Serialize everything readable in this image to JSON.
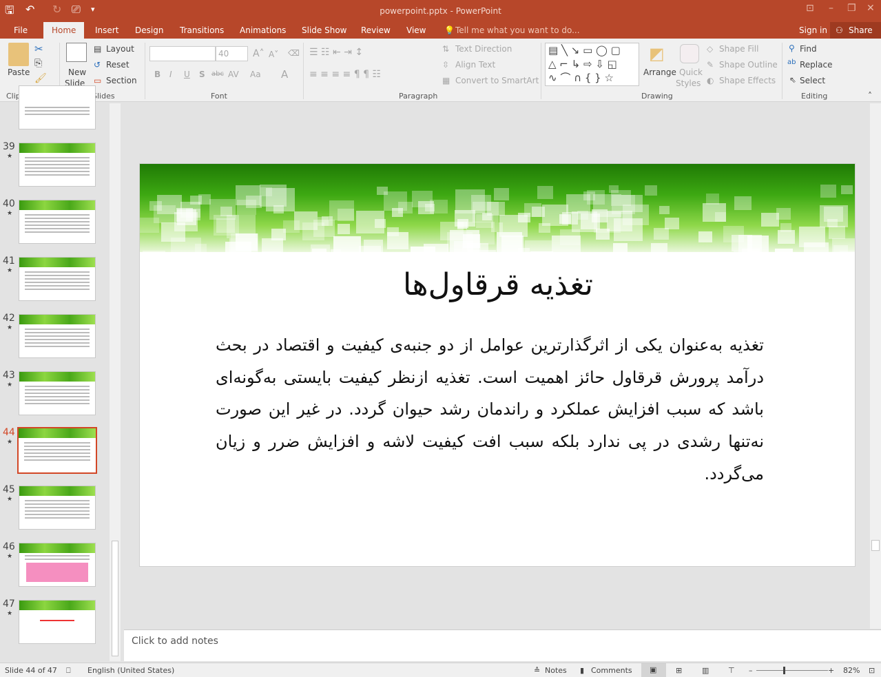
{
  "window": {
    "title": "powerpoint.pptx - PowerPoint",
    "sign_in": "Sign in",
    "share": "Share",
    "tell_me": "Tell me what you want to do..."
  },
  "tabs": [
    "File",
    "Home",
    "Insert",
    "Design",
    "Transitions",
    "Animations",
    "Slide Show",
    "Review",
    "View"
  ],
  "active_tab": "Home",
  "ribbon": {
    "clipboard": {
      "label": "Clipboard",
      "paste": "Paste"
    },
    "slides": {
      "label": "Slides",
      "new_slide": "New",
      "new_slide2": "Slide",
      "layout": "Layout",
      "reset": "Reset",
      "section": "Section"
    },
    "font": {
      "label": "Font",
      "font_name": "",
      "font_size": "40",
      "bold": "B",
      "italic": "I",
      "underline": "U",
      "shadow": "S",
      "strike": "abc",
      "spacing": "AV",
      "case": "Aa",
      "color": "A"
    },
    "paragraph": {
      "label": "Paragraph",
      "text_direction": "Text Direction",
      "align_text": "Align Text",
      "smartart": "Convert to SmartArt"
    },
    "drawing": {
      "label": "Drawing",
      "arrange": "Arrange",
      "quick": "Quick",
      "styles": "Styles",
      "shape_fill": "Shape Fill",
      "shape_outline": "Shape Outline",
      "shape_effects": "Shape Effects"
    },
    "editing": {
      "label": "Editing",
      "find": "Find",
      "replace": "Replace",
      "select": "Select"
    }
  },
  "thumbnails": [
    {
      "n": "39"
    },
    {
      "n": "40"
    },
    {
      "n": "41"
    },
    {
      "n": "42"
    },
    {
      "n": "43"
    },
    {
      "n": "44",
      "selected": true
    },
    {
      "n": "45"
    },
    {
      "n": "46"
    },
    {
      "n": "47"
    }
  ],
  "slide": {
    "title": "تغذیه قرقاول‌ها",
    "body": "تغذیه به‌عنوان یکی از اثرگذارترین عوامل از دو جنبه‌ی کیفیت و اقتصاد در بحث درآمد پرورش قرقاول حائز اهمیت است. تغذیه ازنظر کیفیت بایستی به‌گونه‌ای باشد که سبب افزایش عملکرد و راندمان رشد حیوان گردد. در غیر این صورت نه‌تنها رشدی در پی ندارد بلکه سبب افت کیفیت لاشه و افزایش ضرر و زیان می‌گردد."
  },
  "notes_placeholder": "Click to add notes",
  "status": {
    "slide": "Slide 44 of 47",
    "language": "English (United States)",
    "notes": "Notes",
    "comments": "Comments",
    "zoom": "82%"
  },
  "colors": {
    "accent": "#b7472a",
    "selection": "#d24726"
  }
}
